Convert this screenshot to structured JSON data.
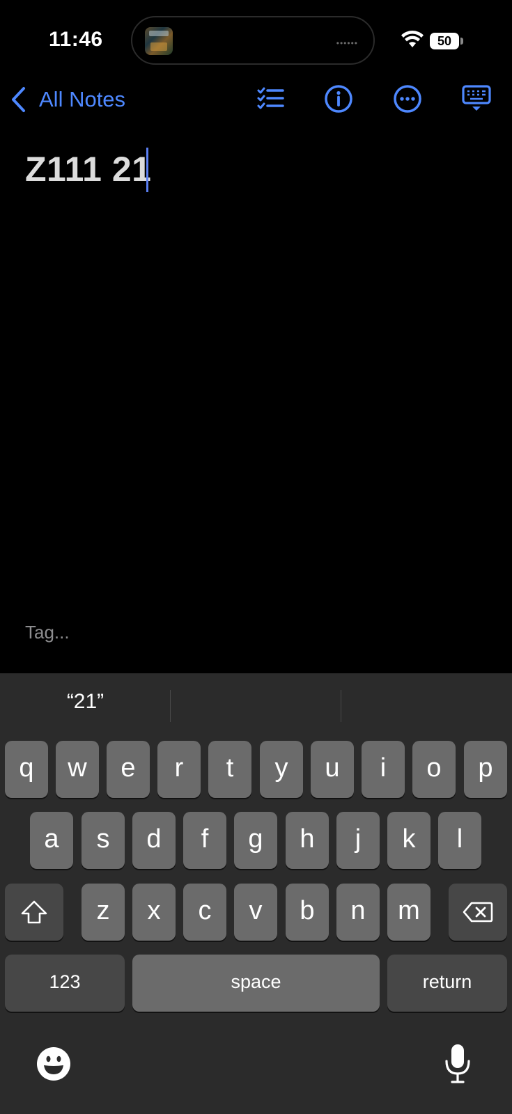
{
  "status_bar": {
    "time": "11:46",
    "battery": "50"
  },
  "nav": {
    "back_label": "All Notes",
    "icons": [
      "checklist-icon",
      "info-icon",
      "more-icon",
      "keyboard-dismiss-icon"
    ],
    "accent_color": "#4e88ff"
  },
  "note": {
    "title": "Z111 21",
    "tag_placeholder": "Tag..."
  },
  "keyboard": {
    "suggestions": [
      "“21”",
      "",
      ""
    ],
    "row1": [
      "q",
      "w",
      "e",
      "r",
      "t",
      "y",
      "u",
      "i",
      "o",
      "p"
    ],
    "row2": [
      "a",
      "s",
      "d",
      "f",
      "g",
      "h",
      "j",
      "k",
      "l"
    ],
    "row3": [
      "z",
      "x",
      "c",
      "v",
      "b",
      "n",
      "m"
    ],
    "numbers_label": "123",
    "space_label": "space",
    "return_label": "return"
  }
}
